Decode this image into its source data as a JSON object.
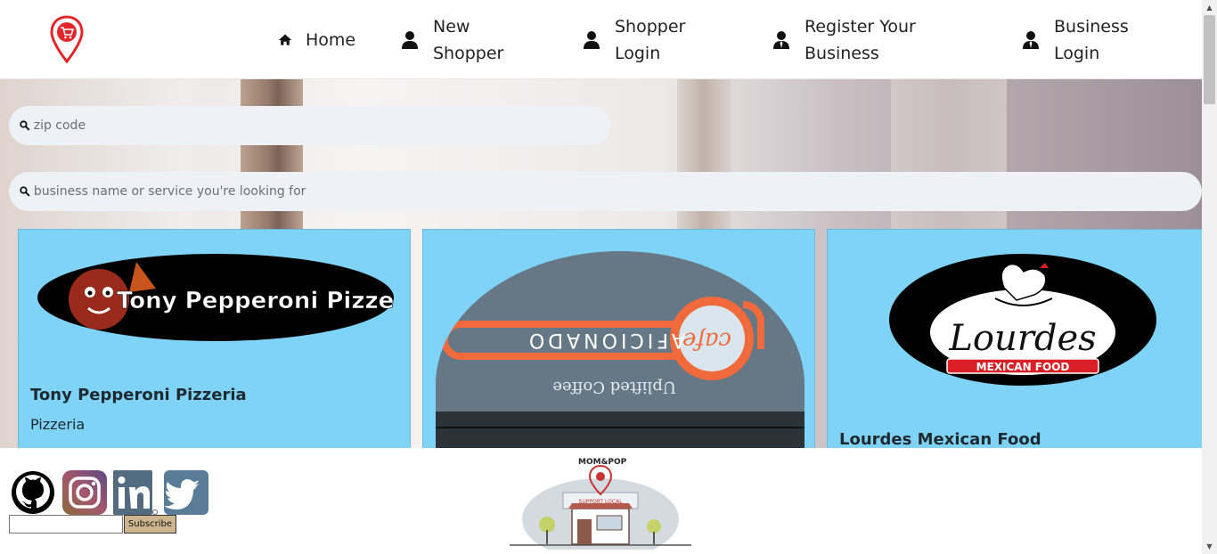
{
  "nav": {
    "home": "Home",
    "new_shopper": "New\nShopper",
    "shopper_login": "Shopper\nLogin",
    "register_business": "Register Your\nBusiness",
    "business_login": "Business\nLogin"
  },
  "search": {
    "zip_placeholder": "zip code",
    "business_placeholder": "business name or service you're looking for"
  },
  "cards": [
    {
      "title": "Tony Pepperoni Pizzeria",
      "subtitle": "Pizzeria",
      "logo_text": "Tony Pepperoni Pizzeria"
    },
    {
      "title": "",
      "subtitle": "",
      "logo_text": "AFICIONADO",
      "logo_subtext": "Uplifted Coffee",
      "logo_script": "cafe"
    },
    {
      "title": "Lourdes Mexican Food",
      "subtitle": "",
      "logo_text": "Lourdes",
      "logo_subtext": "MEXICAN FOOD"
    }
  ],
  "footer": {
    "subscribe_label": "Subscribe",
    "email_value": "",
    "brand_mark": "MOM&POP",
    "brand_tagline": "SUPPORT LOCAL"
  },
  "social": [
    "github-icon",
    "instagram-icon",
    "linkedin-icon",
    "twitter-icon"
  ],
  "colors": {
    "card_bg": "#7fd3f7",
    "search_bg": "#eef1f5",
    "brand_red": "#e3262b",
    "subscribe_bg": "#cdb58f"
  }
}
